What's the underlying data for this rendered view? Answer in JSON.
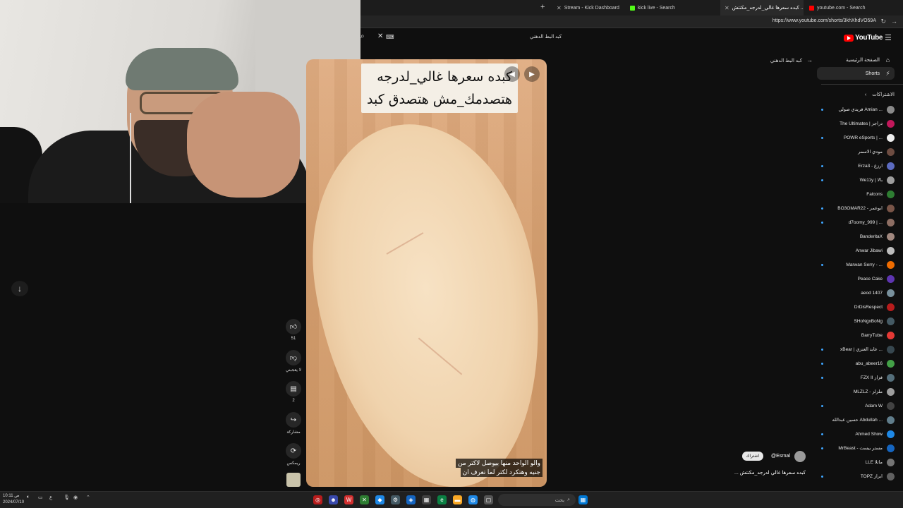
{
  "browser": {
    "tabs": [
      {
        "label": "Stream - Kick Dashboard",
        "fav": "#53fc18"
      },
      {
        "label": "kick live - Search",
        "fav": "#53fc18"
      },
      {
        "label": "كبده سعرها غالي_لدرجه_مكنتش ...",
        "fav": "#ff0000"
      },
      {
        "label": "youtube.com - Search",
        "fav": "#ff0000"
      }
    ],
    "url": "https://www.youtube.com/shorts/3khXhdVO59A"
  },
  "search": {
    "query": "كبد البط الدهني"
  },
  "video": {
    "caption_line1": "كبده سعرها غالي_لدرجه",
    "caption_line2": "هتصدمك_مش هتصدق كبد",
    "subtitle_line1": "والو الواحد منها بيوصل لاكتر من",
    "subtitle_line2": "جنيه وهتكرد لكتر لما تعرف ان"
  },
  "actions": {
    "like_count": "51",
    "dislike_label": "لا يعجبني",
    "comment_count": "2",
    "share_label": "مشاركة",
    "remix_label": "ريمكس"
  },
  "channel": {
    "name": "@Esrnal",
    "subscribe_label": "اشتراك",
    "title": "كبده سعرها غالي لدرجه_مكنتش ..."
  },
  "sidebar": {
    "logo": "YouTube",
    "back_label": "كبد البط الدهني",
    "nav": [
      {
        "label": "الصفحة الرئيسية",
        "icon": "⌂"
      },
      {
        "label": "Shorts",
        "icon": "⚡"
      }
    ],
    "subscriptions_header": "الاشتراكات",
    "subscriptions": [
      {
        "label": "فريدي صولي Amian ...",
        "color": "#8a8a8a",
        "live": true
      },
      {
        "label": "The Ultimates | دراجز",
        "color": "#c2185b",
        "live": false
      },
      {
        "label": "POWR eSports | ...",
        "color": "#eeeeee",
        "live": true
      },
      {
        "label": "مودي الاسمر",
        "color": "#6d4c41",
        "live": false
      },
      {
        "label": "Erza3 - ارزع",
        "color": "#5c6bc0",
        "live": true
      },
      {
        "label": "We11y | بالا",
        "color": "#9e9e9e",
        "live": true
      },
      {
        "label": "Falcons",
        "color": "#2e7d32",
        "live": false
      },
      {
        "label": "BO3OMAR22 - ابوعمر",
        "color": "#795548",
        "live": true
      },
      {
        "label": "d7oomy_999 | ...",
        "color": "#8d6e63",
        "live": true
      },
      {
        "label": "BanderitaX",
        "color": "#a1887f",
        "live": false
      },
      {
        "label": "Anwar Jibawi",
        "color": "#bdbdbd",
        "live": false
      },
      {
        "label": "Marwan Serry - ...",
        "color": "#ef6c00",
        "live": true
      },
      {
        "label": "Peace Cake",
        "color": "#5e35b1",
        "live": false
      },
      {
        "label": "aeod 1407",
        "color": "#78909c",
        "live": false
      },
      {
        "label": "DrDisRespect",
        "color": "#b71c1c",
        "live": false
      },
      {
        "label": "SHoNgxBoNg",
        "color": "#455a64",
        "live": false
      },
      {
        "label": "BarryTube",
        "color": "#e53935",
        "live": false
      },
      {
        "label": "xBear | عابد العنزي ...",
        "color": "#37474f",
        "live": true
      },
      {
        "label": "abu_abeer16",
        "color": "#43a047",
        "live": true
      },
      {
        "label": "FZX II فزاز",
        "color": "#546e7a",
        "live": true
      },
      {
        "label": "MLZLZ - ملزلز",
        "color": "#9e9e9e",
        "live": false
      },
      {
        "label": "Adam W",
        "color": "#424242",
        "live": true
      },
      {
        "label": "حسين عبدالله Abdullah ...",
        "color": "#607d8b",
        "live": false
      },
      {
        "label": "Ahmed Show",
        "color": "#1e88e5",
        "live": true
      },
      {
        "label": "MrBeast - مستر بيست",
        "color": "#1565c0",
        "live": true
      },
      {
        "label": "LLE ماتلا",
        "color": "#757575",
        "live": false
      },
      {
        "label": "TOPZ ابراز",
        "color": "#616161",
        "live": true
      }
    ]
  },
  "taskbar": {
    "search_placeholder": "بحث",
    "time": "10:11 ص",
    "date": "2024/07/10"
  }
}
